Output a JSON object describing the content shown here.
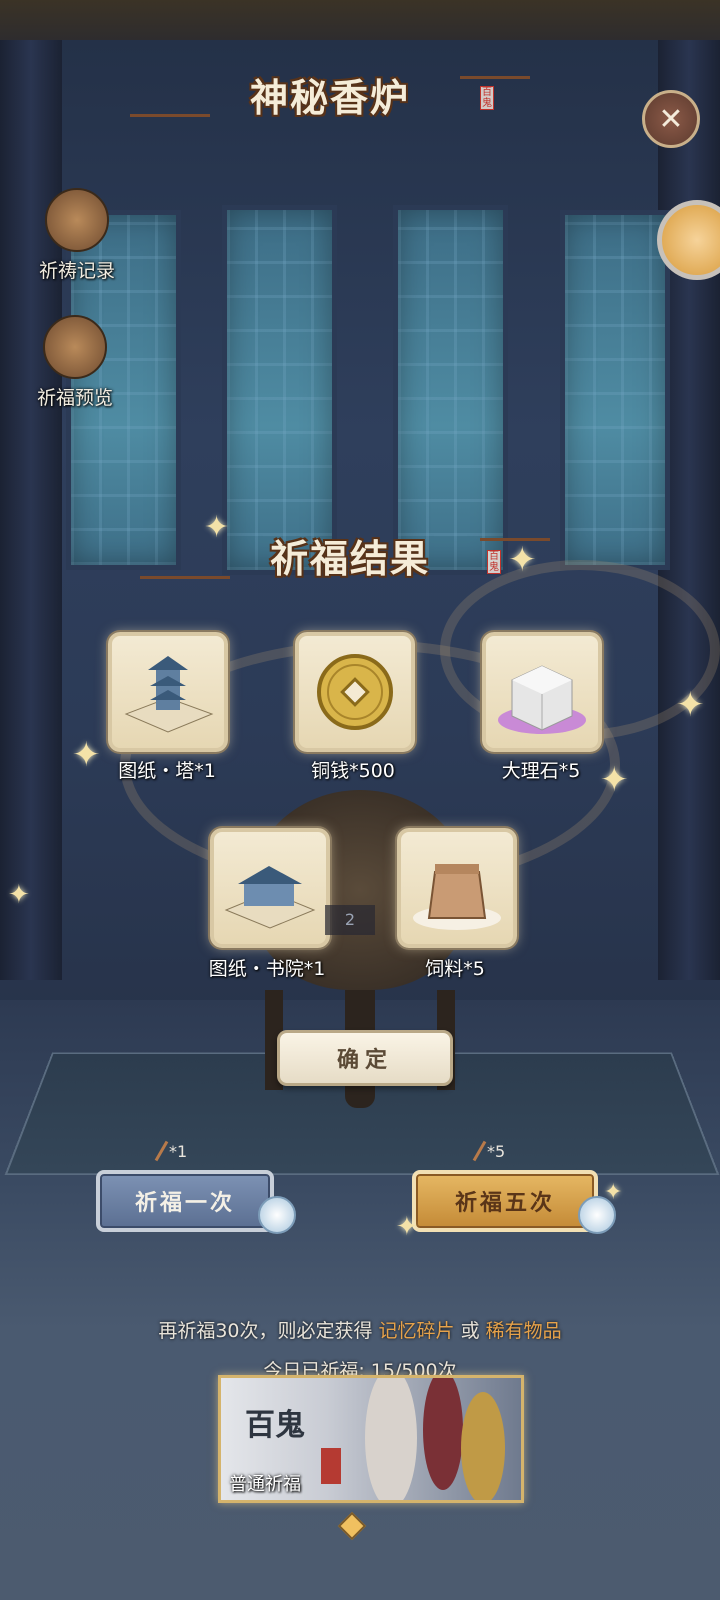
{
  "header": {
    "title": "神秘香炉",
    "seal": "百鬼"
  },
  "side_menu": {
    "records_label": "祈祷记录",
    "preview_label": "祈福预览"
  },
  "result": {
    "title": "祈福结果",
    "seal": "百鬼",
    "items": [
      {
        "label": "图纸・塔*1",
        "icon": "pagoda-blueprint-icon"
      },
      {
        "label": "铜钱*500",
        "icon": "copper-coin-icon"
      },
      {
        "label": "大理石*5",
        "icon": "marble-block-icon"
      },
      {
        "label": "图纸・书院*1",
        "icon": "academy-blueprint-icon"
      },
      {
        "label": "饲料*5",
        "icon": "feed-bag-icon"
      }
    ],
    "confirm_label": "确定"
  },
  "pray": {
    "one_label": "祈福一次",
    "one_cost": "*1",
    "five_label": "祈福五次",
    "five_cost": "*5"
  },
  "info": {
    "prefix": "再祈福30次，则必定获得",
    "item1": "记忆碎片",
    "or": "或",
    "item2": "稀有物品",
    "today": "今日已祈福: 15/500次"
  },
  "pool": {
    "ghost_text": "百鬼",
    "label": "普通祈福"
  },
  "overlay_number": "2",
  "colors": {
    "highlight": "#e6a24a",
    "pray_one": "#6b80a3",
    "pray_five": "#d9a24f"
  }
}
